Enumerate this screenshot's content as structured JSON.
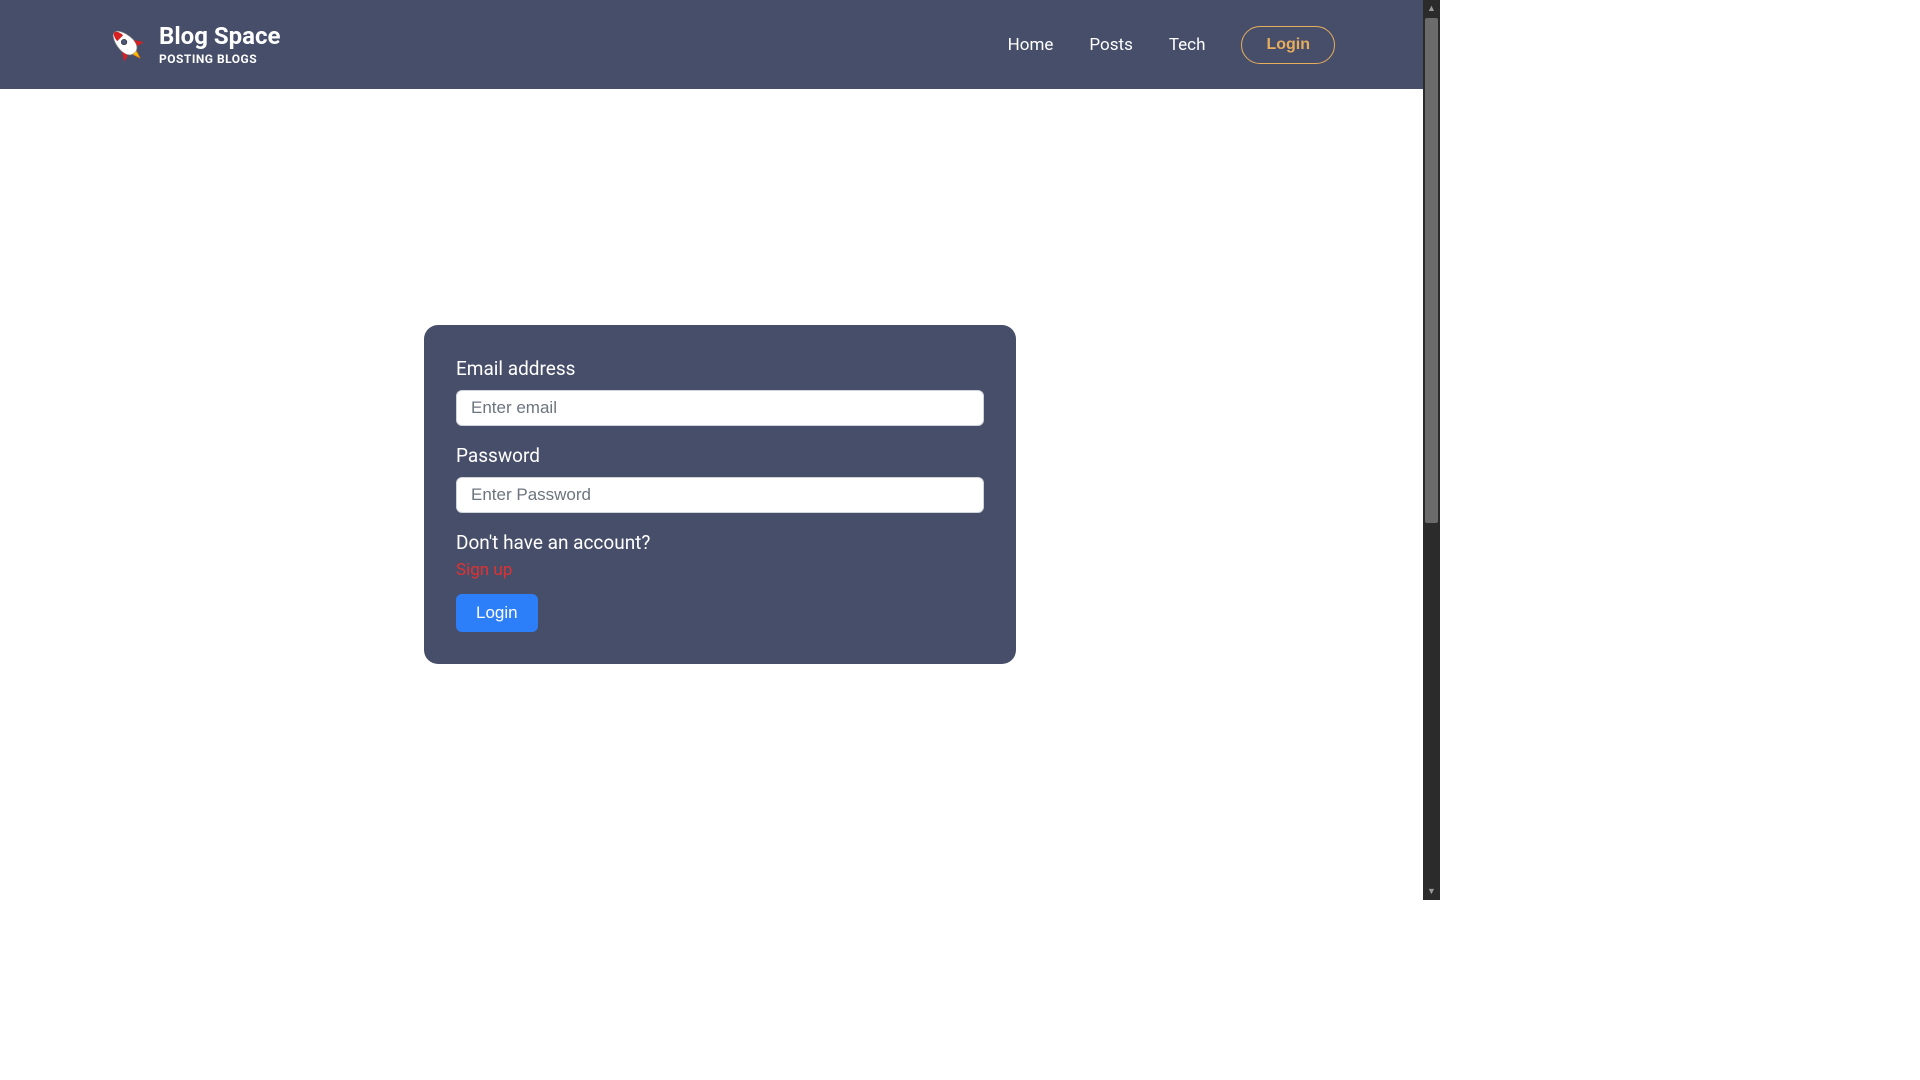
{
  "header": {
    "brand_title": "Blog Space",
    "brand_subtitle": "POSTING BLOGS",
    "nav": {
      "home": "Home",
      "posts": "Posts",
      "tech": "Tech",
      "login": "Login"
    }
  },
  "login_form": {
    "email_label": "Email address",
    "email_placeholder": "Enter email",
    "password_label": "Password",
    "password_placeholder": "Enter Password",
    "signup_prompt": "Don't have an account?",
    "signup_link": "Sign up",
    "submit_label": "Login"
  },
  "colors": {
    "navbar_bg": "#474e6a",
    "accent": "#e7ad5c",
    "signup_link": "#e03131",
    "primary_button": "#2d7ff9"
  }
}
